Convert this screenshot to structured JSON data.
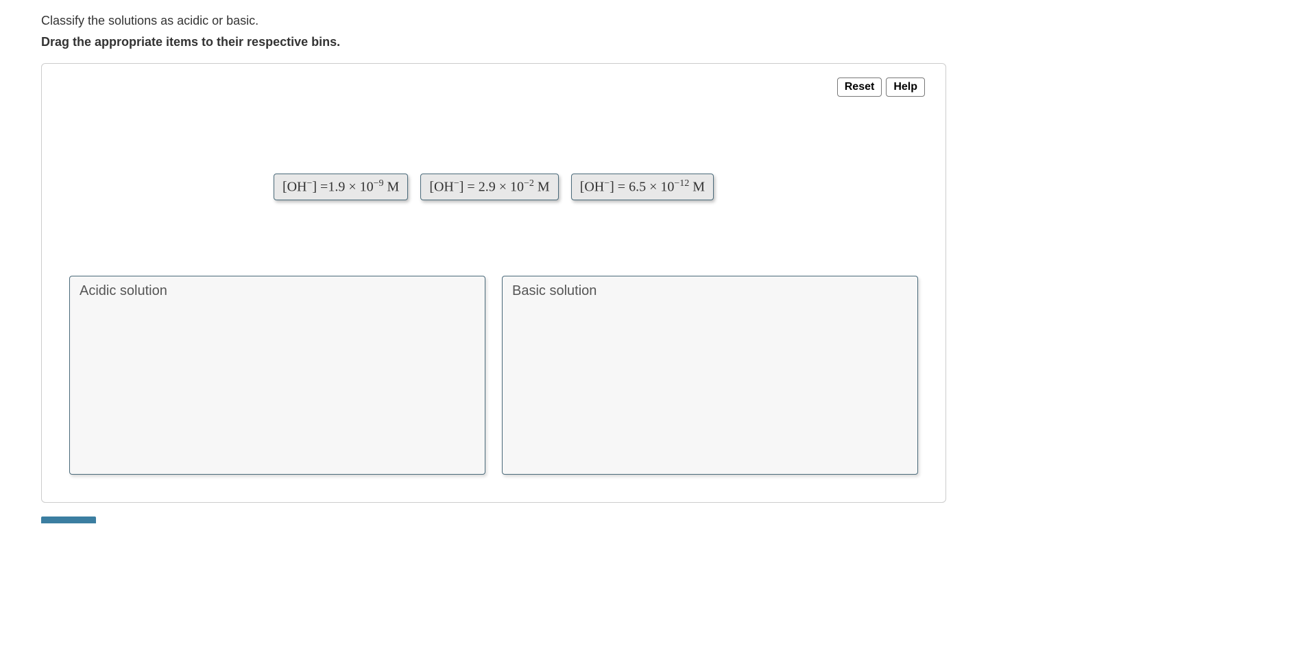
{
  "question": "Classify the solutions as acidic or basic.",
  "instruction": "Drag the appropriate items to their respective bins.",
  "toolbar": {
    "reset": "Reset",
    "help": "Help"
  },
  "items": [
    {
      "prefix": "[OH",
      "sup1": "−",
      "mid1": "] =1.9 × 10",
      "sup2": "−9",
      "suffix": " M"
    },
    {
      "prefix": "[OH",
      "sup1": "−",
      "mid1": "] = 2.9 × 10",
      "sup2": "−2",
      "suffix": " M"
    },
    {
      "prefix": "[OH",
      "sup1": "−",
      "mid1": "] = 6.5 × 10",
      "sup2": "−12",
      "suffix": " M"
    }
  ],
  "bins": {
    "acidic": "Acidic solution",
    "basic": "Basic solution"
  }
}
